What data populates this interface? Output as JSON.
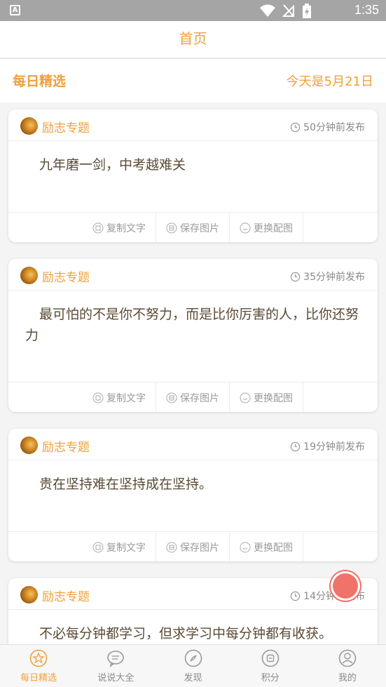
{
  "status_bar": {
    "time": "1:35",
    "app_badge": "A"
  },
  "title_bar": {
    "title": "首页"
  },
  "subheader": {
    "section": "每日精选",
    "date_text": "今天是5月21日"
  },
  "cards": [
    {
      "topic": "励志专题",
      "time": "50分钟前发布",
      "text": "九年磨一剑，中考越难关"
    },
    {
      "topic": "励志专题",
      "time": "35分钟前发布",
      "text": "最可怕的不是你不努力，而是比你厉害的人，比你还努力"
    },
    {
      "topic": "励志专题",
      "time": "19分钟前发布",
      "text": "贵在坚持难在坚持成在坚持。"
    },
    {
      "topic": "励志专题",
      "time": "14分钟前发布",
      "text": "不必每分钟都学习，但求学习中每分钟都有收获。"
    }
  ],
  "actions": {
    "copy": "复制文字",
    "save": "保存图片",
    "change": "更换配图"
  },
  "tabs": [
    {
      "label": "每日精选",
      "icon": "star-icon"
    },
    {
      "label": "说说大全",
      "icon": "chat-icon"
    },
    {
      "label": "发现",
      "icon": "compass-icon"
    },
    {
      "label": "积分",
      "icon": "points-icon"
    },
    {
      "label": "我的",
      "icon": "user-icon"
    }
  ],
  "colors": {
    "accent": "#f0a03c",
    "fab": "#f0736a",
    "statusbar": "#a5a5a5"
  }
}
